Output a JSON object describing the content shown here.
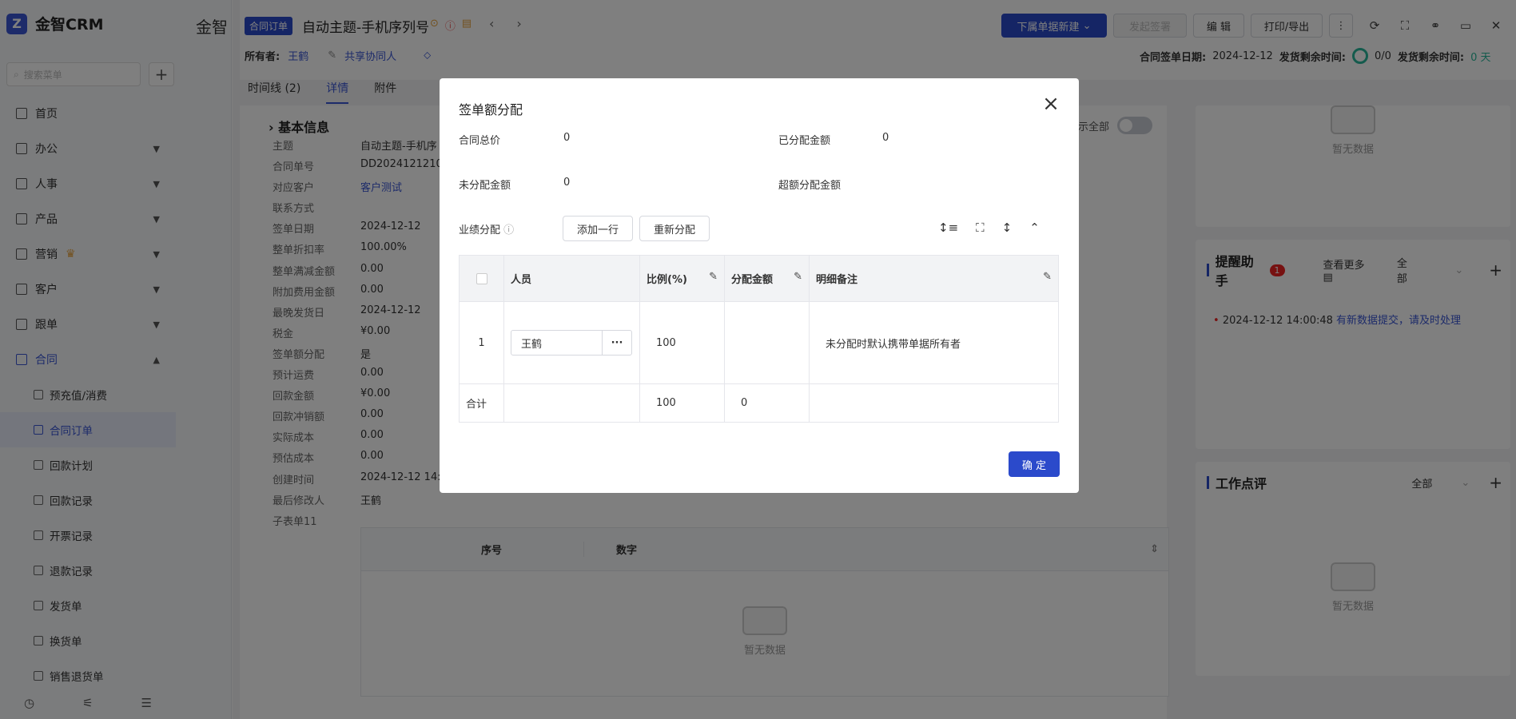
{
  "sidebar": {
    "logo_text": "金智CRM",
    "search_placeholder": "搜索菜单",
    "items": [
      {
        "label": "首页"
      },
      {
        "label": "办公"
      },
      {
        "label": "人事"
      },
      {
        "label": "产品"
      },
      {
        "label": "营销"
      },
      {
        "label": "客户"
      },
      {
        "label": "跟单"
      },
      {
        "label": "合同"
      }
    ],
    "sub_items": [
      {
        "label": "预充值/消费"
      },
      {
        "label": "合同订单"
      },
      {
        "label": "回款计划"
      },
      {
        "label": "回款记录"
      },
      {
        "label": "开票记录"
      },
      {
        "label": "退款记录"
      },
      {
        "label": "发货单"
      },
      {
        "label": "换货单"
      },
      {
        "label": "销售退货单"
      }
    ]
  },
  "header": {
    "app_tab": "金智",
    "badge": "合同订单",
    "title": "自动主题-手机序列号",
    "owner_label": "所有者:",
    "owner_value": "王鹤",
    "collab_label": "共享协同人",
    "buttons": {
      "new_sub": "下属单据新建",
      "sign": "发起签署",
      "edit": "编 辑",
      "print": "打印/导出"
    },
    "sign_date_label": "合同签单日期:",
    "sign_date_value": "2024-12-12",
    "ship_remaining_label": "发货剩余时间:",
    "ship_remaining_value": "0/0",
    "ship_remaining_label2": "发货剩余时间:",
    "ship_remaining_value2": "0 天"
  },
  "tabs": [
    "时间线 (2)",
    "详情",
    "附件"
  ],
  "detail": {
    "section_title": "基本信息",
    "show_all": "显示全部",
    "fields": [
      {
        "k": "主题",
        "v": "自动主题-手机序"
      },
      {
        "k": "合同单号",
        "v": "DD20241212100"
      },
      {
        "k": "对应客户",
        "v": "客户测试"
      },
      {
        "k": "联系方式",
        "v": ""
      },
      {
        "k": "签单日期",
        "v": "2024-12-12"
      },
      {
        "k": "整单折扣率",
        "v": "100.00%"
      },
      {
        "k": "整单满减金额",
        "v": "0.00"
      },
      {
        "k": "附加费用金额",
        "v": "0.00"
      },
      {
        "k": "最晚发货日",
        "v": "2024-12-12"
      },
      {
        "k": "税金",
        "v": "¥0.00"
      },
      {
        "k": "签单额分配",
        "v": "是"
      },
      {
        "k": "预计运费",
        "v": "0.00"
      },
      {
        "k": "回款金额",
        "v": "¥0.00"
      },
      {
        "k": "回款冲销额",
        "v": "0.00"
      },
      {
        "k": "实际成本",
        "v": "0.00"
      },
      {
        "k": "预估成本",
        "v": "0.00"
      },
      {
        "k": "创建时间",
        "v": "2024-12-12 14:0"
      },
      {
        "k": "最后修改人",
        "v": "王鹤"
      },
      {
        "k": "子表单11",
        "v": ""
      }
    ],
    "sub_table_headers": [
      "序号",
      "数字"
    ],
    "empty_text": "暂无数据"
  },
  "right": {
    "empty_text": "暂无数据",
    "reminder_title": "提醒助手",
    "reminder_count": "1",
    "see_more": "查看更多",
    "filter_all": "全部",
    "reminder_time": "2024-12-12 14:00:48",
    "reminder_msg": "有新数据提交，请及时处理",
    "review_title": "工作点评",
    "review_filter": "全部"
  },
  "modal": {
    "title": "签单额分配",
    "total_label": "合同总价",
    "total_value": "0",
    "allocated_label": "已分配金额",
    "allocated_value": "0",
    "unallocated_label": "未分配金额",
    "unallocated_value": "0",
    "over_label": "超额分配金额",
    "over_value": "",
    "perf_label": "业绩分配",
    "add_row": "添加一行",
    "reallocate": "重新分配",
    "columns": {
      "person": "人员",
      "ratio": "比例(%)",
      "amount": "分配金额",
      "note": "明细备注"
    },
    "row": {
      "index": "1",
      "person": "王鹤",
      "ratio": "100",
      "amount": "",
      "note": "未分配时默认携带单据所有者"
    },
    "total_row": {
      "label": "合计",
      "ratio": "100",
      "amount": "0"
    },
    "confirm": "确 定"
  }
}
